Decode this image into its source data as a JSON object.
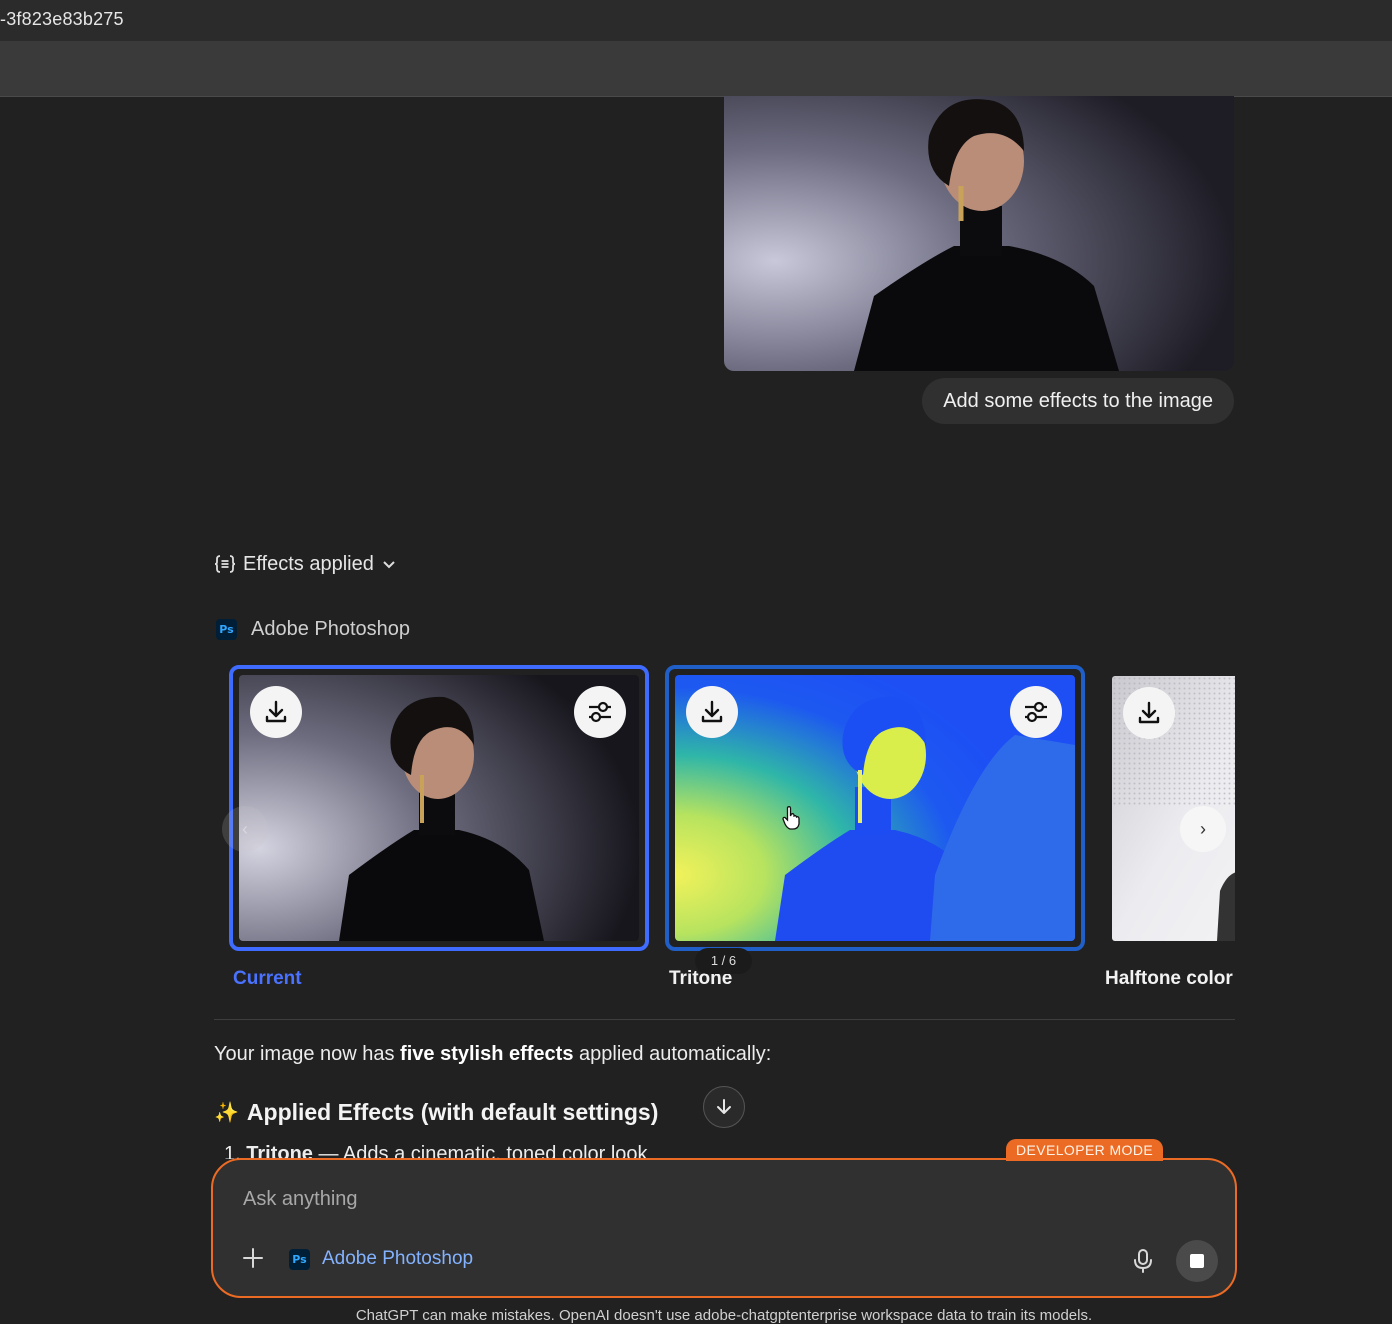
{
  "window": {
    "title": "-3f823e83b275"
  },
  "chat": {
    "user_message": "Add some effects to the image",
    "effects_toggle": "Effects applied",
    "app_name": "Adobe Photoshop",
    "carousel": {
      "counter": "1 / 6",
      "items": [
        {
          "label": "Current",
          "selected": true
        },
        {
          "label": "Tritone",
          "selected": false
        },
        {
          "label": "Halftone color",
          "selected": false
        }
      ]
    },
    "summary": {
      "pre": "Your image now has ",
      "bold": "five stylish effects",
      "post": " applied automatically:"
    },
    "heading_icon": "✨",
    "heading": "Applied Effects (with default settings)",
    "list": [
      {
        "number": "1.",
        "title": "Tritone",
        "desc": " — Adds a cinematic, toned color look"
      }
    ]
  },
  "composer": {
    "developer_badge": "DEVELOPER MODE",
    "placeholder": "Ask anything",
    "tool_chip": "Adobe Photoshop"
  },
  "footer": "ChatGPT can make mistakes. OpenAI doesn't use adobe-chatgptenterprise workspace data to train its models.",
  "colors": {
    "accent_orange": "#ec6b24",
    "selected_blue": "#3f6bff",
    "link_blue": "#83b2ff"
  }
}
